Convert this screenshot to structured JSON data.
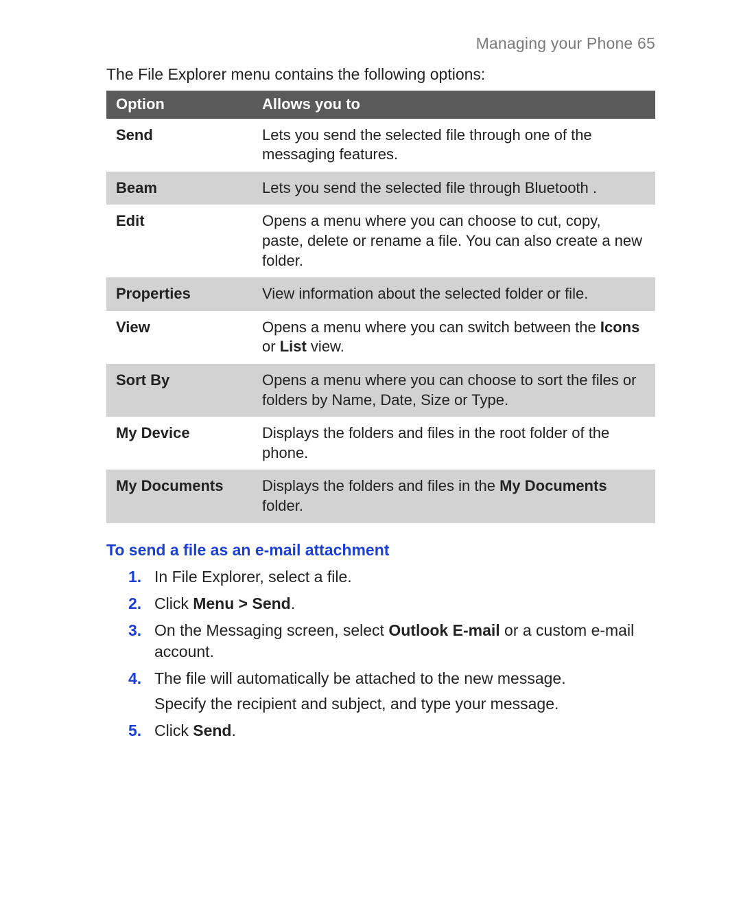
{
  "running_head": "Managing your Phone  65",
  "intro": "The File Explorer menu contains the following options:",
  "table": {
    "headers": {
      "option": "Option",
      "desc": "Allows you to"
    },
    "rows": [
      {
        "option": "Send",
        "desc": "Lets you send the selected file through one of the messaging features."
      },
      {
        "option": "Beam",
        "desc": "Lets you send the selected file through Bluetooth ."
      },
      {
        "option": "Edit",
        "desc": "Opens a menu where you can choose to cut, copy, paste, delete or rename a file. You can also create a new folder."
      },
      {
        "option": "Properties",
        "desc": "View information about the selected folder or file."
      },
      {
        "option": "View",
        "desc_pre": "Opens a menu where you can switch between the ",
        "b1": "Icons",
        "mid": " or ",
        "b2": "List",
        "desc_post": " view."
      },
      {
        "option": "Sort By",
        "desc": "Opens a menu where you can choose to sort the files or folders by Name, Date, Size or Type."
      },
      {
        "option": "My Device",
        "desc": "Displays the folders and files in the root folder of the phone."
      },
      {
        "option": "My Documents",
        "desc_pre": "Displays the folders and files in the ",
        "b1": "My Documents",
        "desc_post": " folder."
      }
    ]
  },
  "section_heading": "To send a file as an e-mail attachment",
  "steps": {
    "s1": "In File Explorer, select a file.",
    "s2_pre": "Click ",
    "s2_b": "Menu > Send",
    "s2_post": ".",
    "s3_pre": "On the Messaging screen, select ",
    "s3_b": "Outlook E-mail",
    "s3_post": " or a custom e-mail account.",
    "s4_line1": "The file will automatically be attached to the new message.",
    "s4_line2": "Specify the recipient and subject, and type your message.",
    "s5_pre": "Click ",
    "s5_b": "Send",
    "s5_post": "."
  }
}
